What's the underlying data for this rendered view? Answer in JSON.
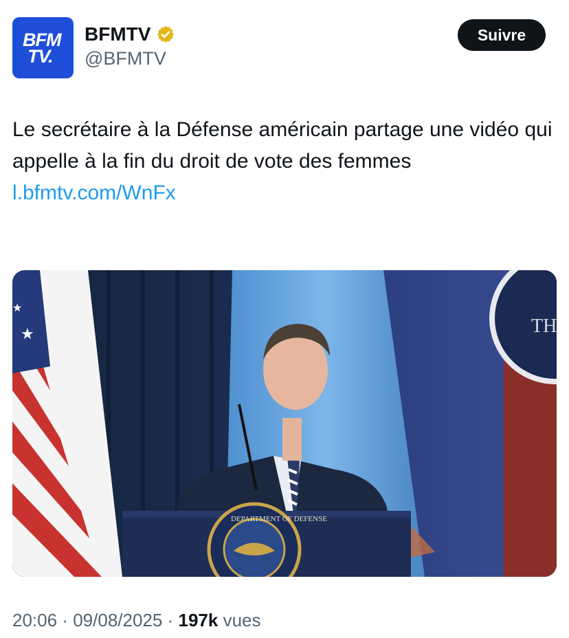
{
  "header": {
    "avatar_text": [
      "BFM",
      "TV."
    ],
    "display_name": "BFMTV",
    "handle": "@BFMTV",
    "follow_label": "Suivre",
    "verified_icon": "verified-gold-badge"
  },
  "tweet": {
    "text": "Le secrétaire à la Défense américain partage une vidéo qui appelle à la fin du droit de vote des femmes",
    "link": "l.bfmtv.com/WnFx"
  },
  "media": {
    "seal_text": "DEPARTMENT OF DEFENSE",
    "wall_text": "TH"
  },
  "meta": {
    "time": "20:06",
    "date": "09/08/2025",
    "separator": "·",
    "views_count": "197k",
    "views_label": "vues"
  },
  "colors": {
    "accent_link": "#1d9bf0",
    "brand_blue": "#1f4fd8",
    "verified_gold": "#e2b719",
    "muted_text": "#536471"
  }
}
